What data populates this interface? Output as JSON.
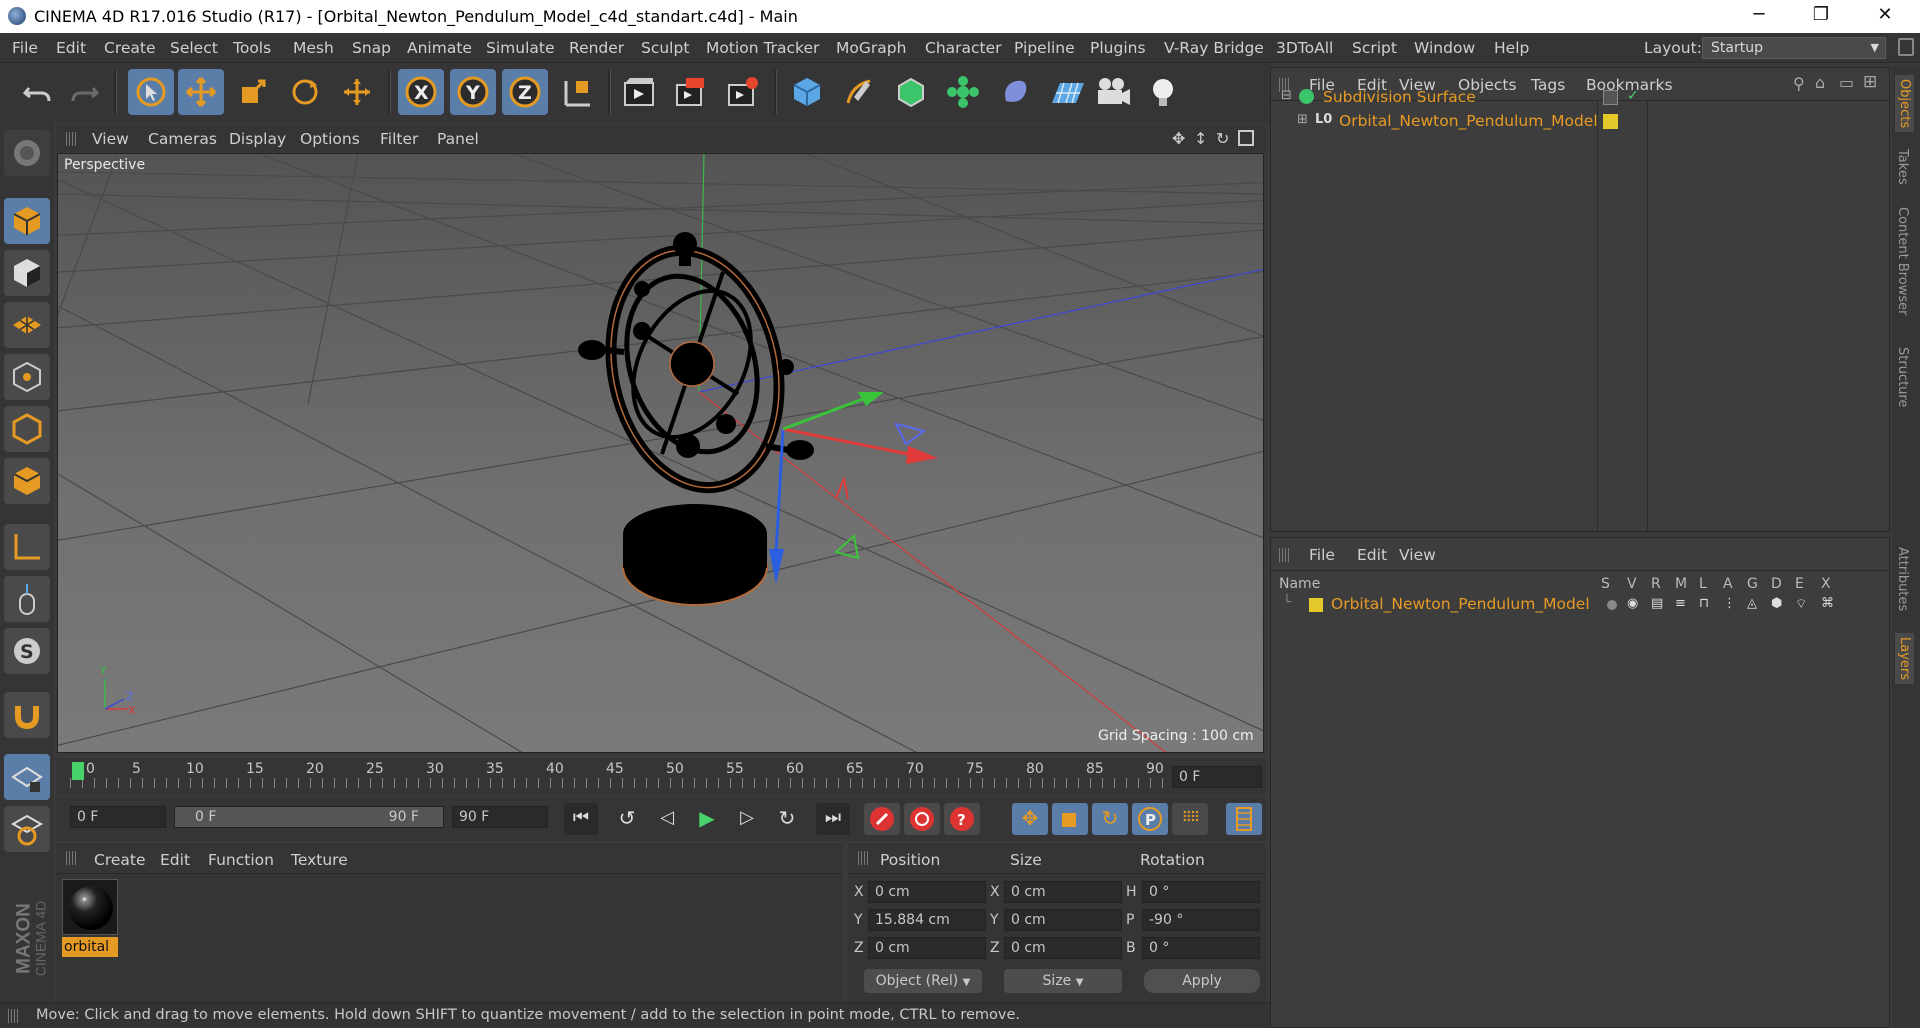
{
  "window": {
    "title": "CINEMA 4D R17.016 Studio (R17) - [Orbital_Newton_Pendulum_Model_c4d_standart.c4d] - Main",
    "minimize": "─",
    "maximize": "❐",
    "close": "✕"
  },
  "menu": [
    "File",
    "Edit",
    "Create",
    "Select",
    "Tools",
    "Mesh",
    "Snap",
    "Animate",
    "Simulate",
    "Render",
    "Sculpt",
    "Motion Tracker",
    "MoGraph",
    "Character",
    "Pipeline",
    "Plugins",
    "V-Ray Bridge",
    "3DToAll",
    "Script",
    "Window",
    "Help"
  ],
  "layout": {
    "label": "Layout:",
    "value": "Startup"
  },
  "viewport": {
    "menu": [
      "View",
      "Cameras",
      "Display",
      "Options",
      "Filter",
      "Panel"
    ],
    "camera_label": "Perspective",
    "grid_spacing": "Grid Spacing : 100 cm",
    "axis_x": "X",
    "axis_y": "Y",
    "axis_z": "Z"
  },
  "timeline": {
    "ticks": [
      "0",
      "5",
      "10",
      "15",
      "20",
      "25",
      "30",
      "35",
      "40",
      "45",
      "50",
      "55",
      "60",
      "65",
      "70",
      "75",
      "80",
      "85",
      "90"
    ],
    "current_frame": "0 F"
  },
  "transport": {
    "start": "0 F",
    "range_start": "0 F",
    "range_end": "90 F",
    "end": "90 F"
  },
  "materials": {
    "menu": [
      "Create",
      "Edit",
      "Function",
      "Texture"
    ],
    "items": [
      {
        "name": "orbital"
      }
    ]
  },
  "coords": {
    "headers": [
      "Position",
      "Size",
      "Rotation"
    ],
    "rows": [
      {
        "pl": "X",
        "p": "0 cm",
        "sl": "X",
        "s": "0 cm",
        "rl": "H",
        "r": "0 °"
      },
      {
        "pl": "Y",
        "p": "15.884 cm",
        "sl": "Y",
        "s": "0 cm",
        "rl": "P",
        "r": "-90 °"
      },
      {
        "pl": "Z",
        "p": "0 cm",
        "sl": "Z",
        "s": "0 cm",
        "rl": "B",
        "r": "0 °"
      }
    ],
    "mode": "Object (Rel)",
    "size_mode": "Size",
    "apply": "Apply"
  },
  "status": "Move: Click and drag to move elements. Hold down SHIFT to quantize movement / add to the selection in point mode, CTRL to remove.",
  "objects": {
    "menu": [
      "File",
      "Edit",
      "View",
      "Objects",
      "Tags",
      "Bookmarks"
    ],
    "items": [
      {
        "name": "Subdivision Surface"
      },
      {
        "name": "Orbital_Newton_Pendulum_Model"
      }
    ]
  },
  "layers": {
    "menu": [
      "File",
      "Edit",
      "View"
    ],
    "columns": [
      "Name",
      "S",
      "V",
      "R",
      "M",
      "L",
      "A",
      "G",
      "D",
      "E",
      "X"
    ],
    "items": [
      {
        "name": "Orbital_Newton_Pendulum_Model"
      }
    ]
  },
  "right_tabs": [
    "Objects",
    "Takes",
    "Content Browser",
    "Structure",
    "Attributes",
    "Layers"
  ],
  "brand": {
    "line1": "MAXON",
    "line2": "CINEMA 4D"
  },
  "colors": {
    "accent": "#e79b24",
    "selected": "#5a7ea8",
    "layer_color": "#e5c82a"
  }
}
